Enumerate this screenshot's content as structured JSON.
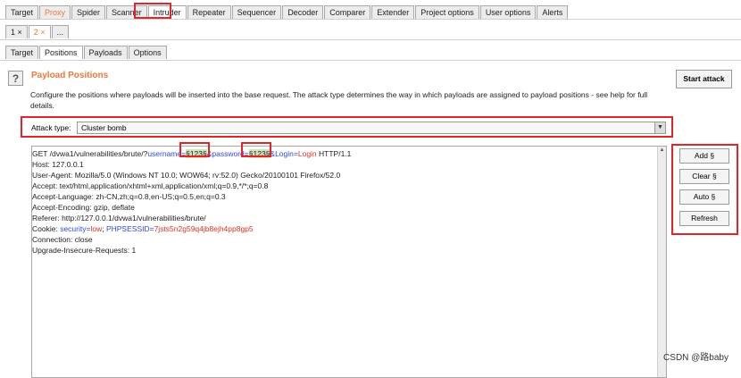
{
  "top_tabs": [
    {
      "label": "Target"
    },
    {
      "label": "Proxy"
    },
    {
      "label": "Spider"
    },
    {
      "label": "Scanner"
    },
    {
      "label": "Intruder"
    },
    {
      "label": "Repeater"
    },
    {
      "label": "Sequencer"
    },
    {
      "label": "Decoder"
    },
    {
      "label": "Comparer"
    },
    {
      "label": "Extender"
    },
    {
      "label": "Project options"
    },
    {
      "label": "User options"
    },
    {
      "label": "Alerts"
    }
  ],
  "attack_tabs": [
    {
      "label": "1 ×"
    },
    {
      "label": "2 ×"
    },
    {
      "label": "..."
    }
  ],
  "sub_tabs": [
    {
      "label": "Target"
    },
    {
      "label": "Positions"
    },
    {
      "label": "Payloads"
    },
    {
      "label": "Options"
    }
  ],
  "panel": {
    "help": "?",
    "title": "Payload Positions",
    "description": "Configure the positions where payloads will be inserted into the base request. The attack type determines the way in which payloads are assigned to payload positions - see help for full details.",
    "start_attack": "Start attack"
  },
  "attack_type": {
    "label": "Attack type:",
    "value": "Cluster bomb"
  },
  "request": {
    "line1_prefix": "GET /dvwa1/vulnerabilities/brute/?",
    "param1_key": "username",
    "eq": "=",
    "marker1": "§123§",
    "amp": "&",
    "param2_key": "password",
    "marker2": "§123§",
    "param3_key": "Login",
    "param3_value": "Login",
    "line1_suffix": " HTTP/1.1",
    "host": "Host: 127.0.0.1",
    "user_agent": "User-Agent: Mozilla/5.0 (Windows NT 10.0; WOW64; rv:52.0) Gecko/20100101 Firefox/52.0",
    "accept": "Accept: text/html,application/xhtml+xml,application/xml;q=0.9,*/*;q=0.8",
    "accept_language": "Accept-Language: zh-CN,zh;q=0.8,en-US;q=0.5,en;q=0.3",
    "accept_encoding": "Accept-Encoding: gzip, deflate",
    "referer": "Referer: http://127.0.0.1/dvwa1/vulnerabilities/brute/",
    "cookie_prefix": "Cookie: ",
    "cookie_key1": "security",
    "cookie_val1": "low",
    "cookie_sep": "; ",
    "cookie_key2": "PHPSESSID",
    "cookie_val2": "7jsts5n2g59q4jb8ejh4pp8gp5",
    "connection": "Connection: close",
    "upgrade": "Upgrade-Insecure-Requests: 1"
  },
  "side_buttons": {
    "add": "Add §",
    "clear": "Clear §",
    "auto": "Auto §",
    "refresh": "Refresh"
  },
  "watermark": "CSDN @路baby",
  "colors": {
    "accent": "#e87a3b",
    "highlight_box": "#e0262b",
    "param_key": "#2d4bd8",
    "param_value": "#d9331f",
    "marker_bg": "#cfe5b9"
  }
}
